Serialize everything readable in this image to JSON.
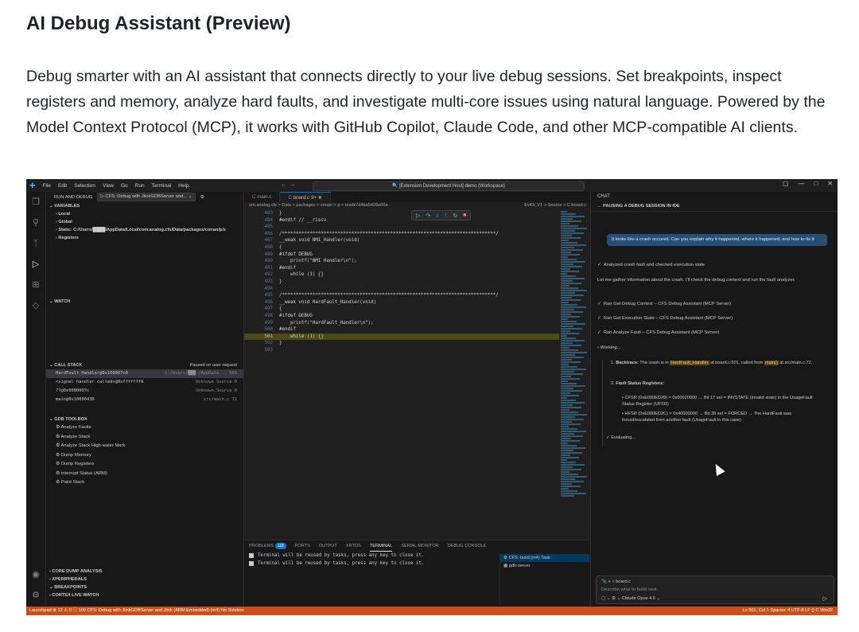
{
  "doc": {
    "title": "AI Debug Assistant (Preview)",
    "paragraph": "Debug smarter with an AI assistant that connects directly to your live debug sessions. Set breakpoints, inspect registers and memory, analyze hard faults, and investigate multi-core issues using natural language. Powered by the Model Context Protocol (MCP), it works with GitHub Copilot, Claude Code, and other MCP-compatible AI clients."
  },
  "ide": {
    "menu": [
      "File",
      "Edit",
      "Selection",
      "View",
      "Go",
      "Run",
      "Terminal",
      "Help"
    ],
    "command_center": "[Extension Development Host] demo (Workspace)",
    "sidebar": {
      "title": "RUN AND DEBUG",
      "config": "CFS: Debug with JlinkGDBServer and...",
      "variables_header": "VARIABLES",
      "variables": [
        "Local",
        "Global",
        "Static: C:/Users/████/AppData/Local/com.analog.cfs/Data/packages/conan/p/s",
        "Registers"
      ],
      "watch_header": "WATCH",
      "callstack_header": "CALL STACK",
      "callstack_status": "Paused on user request",
      "callstack": [
        {
          "name": "HardFault_Handler@0x100007c0",
          "loc": "C:/Users/███ /AppData...  501"
        },
        {
          "name": "<signal handler called>@0xfffffff9",
          "loc": "Unknown Source  0"
        },
        {
          "name": "??@0x0000007c",
          "loc": "Unknown Source  0"
        },
        {
          "name": "main@0x10000438",
          "loc": "src/main.c  72"
        }
      ],
      "toolbox_header": "GDB TOOLBOX",
      "toolbox": [
        "Analyze Faults",
        "Analyze Stack",
        "Analyze Stack High-water Mark",
        "Dump Memory",
        "Dump Registers",
        "Interrupt Status (ARM)",
        "Paint Stack"
      ],
      "bottom_sections": [
        "CORE DUMP ANALYSIS",
        "XPERIPHERALS",
        "BREAKPOINTS",
        "CORTEX LIVE WATCH"
      ]
    },
    "editor": {
      "tabs": [
        "main.c",
        "board.c 9+"
      ],
      "breadcrumb": "om.analog.cfs > Data > packages > conan > p > msdk7d4ba5426e00a",
      "breadcrumb_right": "EvKit_V1 > Source > C board.c",
      "lines": [
        {
          "n": "483",
          "t": "}"
        },
        {
          "n": "484",
          "t": "#endif // __riscv"
        },
        {
          "n": "485",
          "t": ""
        },
        {
          "n": "486",
          "t": "/*****************************************************************************/"
        },
        {
          "n": "487",
          "t": "__weak void NMI_Handler(void)"
        },
        {
          "n": "488",
          "t": "{"
        },
        {
          "n": "489",
          "t": "#ifdef DEBUG"
        },
        {
          "n": "490",
          "t": "    printf(\"NMI Handler\\n\");"
        },
        {
          "n": "491",
          "t": "#endif"
        },
        {
          "n": "492",
          "t": "    while (1) {}"
        },
        {
          "n": "493",
          "t": "}"
        },
        {
          "n": "494",
          "t": ""
        },
        {
          "n": "495",
          "t": "/*****************************************************************************/"
        },
        {
          "n": "496",
          "t": "__weak void HardFault_Handler(void)"
        },
        {
          "n": "497",
          "t": "{"
        },
        {
          "n": "498",
          "t": "#ifdef DEBUG"
        },
        {
          "n": "499",
          "t": "    printf(\"HardFault_Handler\\n\");"
        },
        {
          "n": "500",
          "t": "#endif"
        },
        {
          "n": "501",
          "t": "    while (1) {}"
        },
        {
          "n": "502",
          "t": "}"
        },
        {
          "n": "503",
          "t": ""
        }
      ],
      "highlight_line": "501"
    },
    "panel": {
      "tabs": [
        "PROBLEMS",
        "PORTS",
        "OUTPUT",
        "XRTOS",
        "TERMINAL",
        "SERIAL MONITOR",
        "DEBUG CONSOLE"
      ],
      "problems_count": "118",
      "terminal_lines": [
        "Terminal will be reused by tasks, press any key to close it.",
        "Terminal will be reused by tasks, press any key to close it."
      ],
      "terminals": [
        "CFS: build (m4)  Task",
        "gdb-server"
      ]
    },
    "chat": {
      "header": "CHAT",
      "session": "PAUSING A DEBUG SESSION IN IDE",
      "user_message": "It looks like a crash occured. Can you explain why it happened, where it happened, and how to fix it",
      "step1": "Analyzed crash fault and checked execution state",
      "intro": "Let me gather information about the crash. I'll check the debug context and run the fault analyzer.",
      "tools": [
        "Ran Get Debug Context – CFS Debug Assistant (MCP Server)",
        "Ran Get Execution State – CFS Debug Assistant (MCP Server)",
        "Ran Analyze Fault – CFS Debug Assistant (MCP Server)"
      ],
      "working": "Working...",
      "item1_label": "Backtrace:",
      "item1_text_a": "The crash is in",
      "item1_code": "HardFault_Handler",
      "item1_text_b": "at board.c:501, called from",
      "item1_code2": "main()",
      "item1_text_c": "at src/main.c:72.",
      "item2": "Fault Status Registers:",
      "bullet1": "CFSR (0xE000ED28) = 0x00020000 → Bit 17 set = INVSTATE (Invalid state) in the UsageFault Status Register (UFSR)",
      "bullet2": "HFSR (0xE000ED2C) = 0x40000000 → Bit 30 set = FORCED → The HardFault was forced/escalated from another fault (UsageFault in this case)",
      "evaluating": "Evaluating...",
      "input_chip": "board.c",
      "input_placeholder": "Describe what to build next",
      "model": "Claude Opus 4.6"
    },
    "statusbar": {
      "left": "Launchpad   ⊗ 12 ⚠ 0 ⓘ 100   CFS: Debug with JlinkGDBServer and Jlink (ARM Embedded) (m4)   No Solution",
      "right": "Ln 501, Col 1   Spaces: 4   UTF-8   LF   {} C   Win32"
    }
  }
}
